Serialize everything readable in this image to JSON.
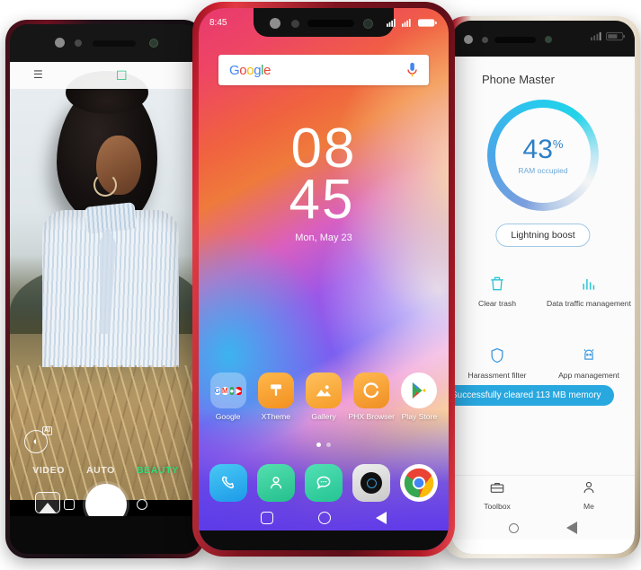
{
  "scene": {
    "description": "Three smartphones product shot",
    "background": "#ffffff"
  },
  "left_phone": {
    "name": "camera-phone",
    "frame_color": "#6d1020",
    "app": "Camera",
    "status_icons": [
      "hdr-icon",
      "sd-card-icon"
    ],
    "ai_badge": "AI",
    "modes": [
      {
        "label": "VIDEO",
        "active": false
      },
      {
        "label": "AUTO",
        "active": false
      },
      {
        "label": "BEAUTY",
        "active": true
      }
    ],
    "active_mode_color": "#2ee07a",
    "shutter": "shutter-button",
    "gallery_thumb": "gallery-thumbnail",
    "nav": [
      "recents",
      "home"
    ]
  },
  "center_phone": {
    "name": "home-screen-phone",
    "frame_color": "#c9202f",
    "status": {
      "time": "8:45",
      "signal": "4G",
      "battery": "battery-full"
    },
    "search": {
      "logo": "Google",
      "logo_letters": [
        "G",
        "o",
        "o",
        "g",
        "l",
        "e"
      ],
      "mic": "microphone-icon"
    },
    "clock": {
      "hours": "08",
      "minutes": "45",
      "date": "Mon, May 23"
    },
    "apps": [
      {
        "label": "Google",
        "type": "folder",
        "items": [
          "G",
          "M",
          "▶",
          "▶"
        ]
      },
      {
        "label": "XTheme",
        "type": "icon",
        "glyph": "὘c",
        "bg": "#f5a623"
      },
      {
        "label": "Gallery",
        "type": "icon",
        "glyph": "⛰",
        "bg": "#f7a93b"
      },
      {
        "label": "PHX Browser",
        "type": "icon",
        "glyph": "↻",
        "bg": "#f59a2e"
      },
      {
        "label": "Play Store",
        "type": "icon",
        "glyph": "▶",
        "bg": "#ffffff"
      }
    ],
    "page_dots": {
      "count": 2,
      "active": 0
    },
    "dock": [
      {
        "name": "phone",
        "glyph": "✆",
        "bg": "#2bb6f0"
      },
      {
        "name": "contacts",
        "glyph": "὆4",
        "bg": "#3fd2a0"
      },
      {
        "name": "messages",
        "glyph": "…",
        "bg": "#3ed8a8"
      },
      {
        "name": "camera",
        "glyph": "◉",
        "bg": "#d6d6d6"
      },
      {
        "name": "chrome",
        "glyph": "●",
        "bg": "#ffffff"
      }
    ],
    "nav": [
      "recents",
      "home",
      "back"
    ]
  },
  "right_phone": {
    "name": "phone-master-phone",
    "frame_color": "#b5202c",
    "title": "Phone Master",
    "ram": {
      "value": "43",
      "unit": "%",
      "label": "RAM occupied",
      "color": "#2c7fc6"
    },
    "boost_button": "Lightning boost",
    "features": [
      {
        "label": "Clear trash",
        "icon": "trash-icon"
      },
      {
        "label": "Data traffic management",
        "icon": "bar-chart-icon"
      },
      {
        "label": "Harassment filter",
        "icon": "shield-icon"
      },
      {
        "label": "App management",
        "icon": "android-icon"
      }
    ],
    "toast": "Successfully cleared 113 MB memory",
    "toast_color": "#29a8e0",
    "bottom_nav": [
      {
        "label": "Toolbox",
        "icon": "toolbox-icon"
      },
      {
        "label": "Me",
        "icon": "person-icon"
      }
    ],
    "nav": [
      "home",
      "back"
    ]
  }
}
